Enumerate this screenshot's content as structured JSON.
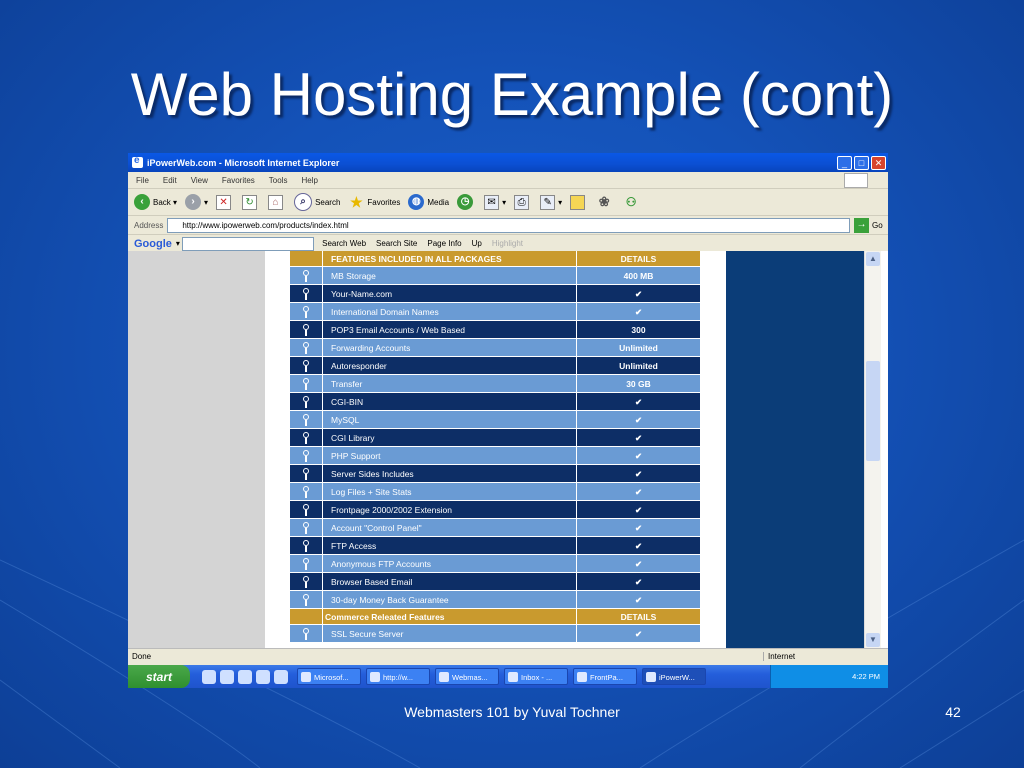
{
  "slide": {
    "title": "Web Hosting Example (cont)",
    "footer": "Webmasters 101 by Yuval Tochner",
    "page_number": "42"
  },
  "browser": {
    "window_title": "iPowerWeb.com - Microsoft Internet Explorer",
    "menu": [
      "File",
      "Edit",
      "View",
      "Favorites",
      "Tools",
      "Help"
    ],
    "toolbar": {
      "back": "Back",
      "search": "Search",
      "favorites": "Favorites",
      "media": "Media"
    },
    "address_label": "Address",
    "address_value": "http://www.ipowerweb.com/products/index.html",
    "go_label": "Go",
    "google": {
      "logo": "Google",
      "search_web": "Search Web",
      "search_site": "Search Site",
      "page_info": "Page Info",
      "up": "Up",
      "highlight": "Highlight"
    },
    "status_text": "Done",
    "zone_text": "Internet"
  },
  "features": {
    "header": {
      "name": "FEATURES INCLUDED IN ALL PACKAGES",
      "details": "DETAILS"
    },
    "rows": [
      {
        "name": "MB Storage",
        "details": "400 MB"
      },
      {
        "name": "Your-Name.com",
        "details": "✔"
      },
      {
        "name": "International Domain Names",
        "details": "✔"
      },
      {
        "name": "POP3 Email Accounts / Web Based",
        "details": "300"
      },
      {
        "name": "Forwarding Accounts",
        "details": "Unlimited"
      },
      {
        "name": "Autoresponder",
        "details": "Unlimited"
      },
      {
        "name": "Transfer",
        "details": "30 GB"
      },
      {
        "name": "CGI-BIN",
        "details": "✔"
      },
      {
        "name": "MySQL",
        "details": "✔"
      },
      {
        "name": "CGI Library",
        "details": "✔"
      },
      {
        "name": "PHP Support",
        "details": "✔"
      },
      {
        "name": "Server Sides Includes",
        "details": "✔"
      },
      {
        "name": "Log Files + Site Stats",
        "details": "✔"
      },
      {
        "name": "Frontpage 2000/2002 Extension",
        "details": "✔"
      },
      {
        "name": "Account \"Control Panel\"",
        "details": "✔"
      },
      {
        "name": "FTP Access",
        "details": "✔"
      },
      {
        "name": "Anonymous FTP Accounts",
        "details": "✔"
      },
      {
        "name": "Browser Based Email",
        "details": "✔"
      },
      {
        "name": "30-day Money Back Guarantee",
        "details": "✔"
      }
    ],
    "commerce_header": {
      "name": "Commerce Releated Features",
      "details": "DETAILS"
    },
    "commerce_rows": [
      {
        "name": "SSL Secure Server",
        "details": "✔"
      }
    ]
  },
  "taskbar": {
    "start": "start",
    "tasks": [
      "Microsof...",
      "http://w...",
      "Webmas...",
      "Inbox - ...",
      "FrontPa...",
      "iPowerW..."
    ],
    "clock": "4:22 PM"
  }
}
